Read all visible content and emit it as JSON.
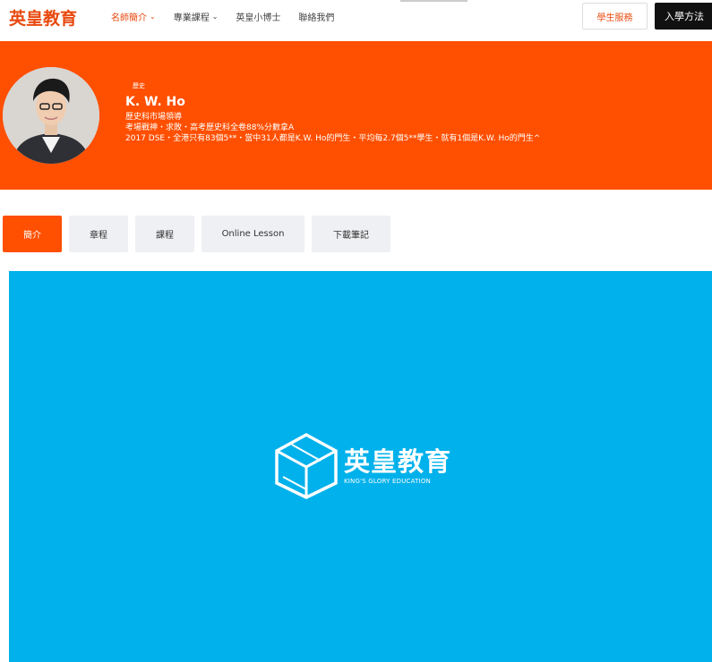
{
  "header": {
    "logo": "英皇教育",
    "nav": [
      {
        "label": "名師簡介",
        "active": true,
        "dropdown": true
      },
      {
        "label": "專業課程",
        "active": false,
        "dropdown": true
      },
      {
        "label": "英皇小博士",
        "active": false,
        "dropdown": false
      },
      {
        "label": "聯絡我們",
        "active": false,
        "dropdown": false
      }
    ],
    "student_service": "學生服務",
    "admission": "入學方法"
  },
  "teacher": {
    "subject": "歷史",
    "name": "K. W. Ho",
    "lines": [
      "歷史科市場領導",
      "考場戰神・求敗・高考歷史科全卷88%分數拿A",
      "2017 DSE・全港只有83個5**・當中31人都是K.W. Ho的門生・平均每2.7個5**學生・就有1個是K.W. Ho的門生^"
    ]
  },
  "tabs": [
    {
      "label": "簡介",
      "active": true
    },
    {
      "label": "章程",
      "active": false
    },
    {
      "label": "課程",
      "active": false
    },
    {
      "label": "Online Lesson",
      "active": false
    },
    {
      "label": "下載筆記",
      "active": false
    }
  ],
  "video": {
    "logo_cn": "英皇教育",
    "logo_en": "KING'S GLORY EDUCATION"
  },
  "colors": {
    "brand": "#ff4f00",
    "video_bg": "#00b1eb"
  }
}
